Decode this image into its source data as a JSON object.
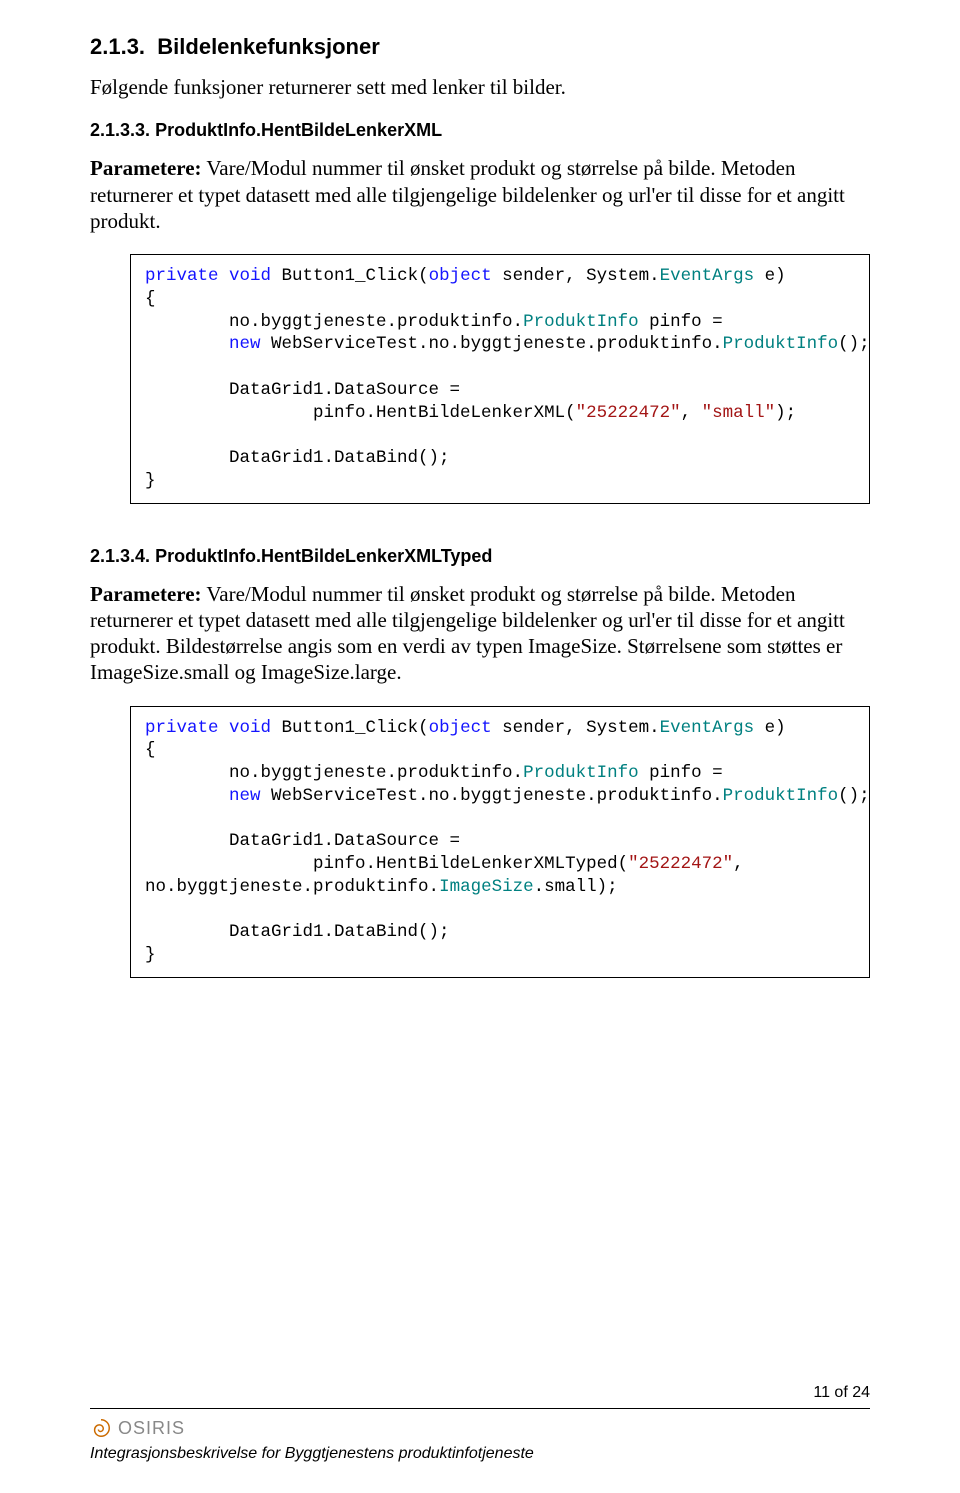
{
  "sec213": {
    "number": "2.1.3.",
    "title": "Bildelenkefunksjoner",
    "intro": "Følgende funksjoner returnerer sett med lenker til bilder."
  },
  "sec2133": {
    "number": "2.1.3.3.",
    "title": "ProduktInfo.HentBildeLenkerXML",
    "body": "Parametere: Vare/Modul nummer til ønsket produkt og størrelse på bilde. Metoden returnerer et typet datasett med alle tilgjengelige bildelenker og url'er til disse for et angitt produkt.",
    "code": {
      "l1a": "private",
      "l1b": "void",
      "l1c": " Button1_Click(",
      "l1d": "object",
      "l1e": " sender, System.",
      "l1f": "EventArgs",
      "l1g": " e)",
      "l2": "{",
      "l3a": "        no.byggtjeneste.produktinfo.",
      "l3b": "ProduktInfo",
      "l3c": " pinfo = ",
      "l4a": "        ",
      "l4b": "new",
      "l4c": " WebServiceTest.no.byggtjeneste.produktinfo.",
      "l4d": "ProduktInfo",
      "l4e": "();",
      "l6a": "        DataGrid1.DataSource = ",
      "l7a": "                pinfo.HentBildeLenkerXML(",
      "l7b": "\"25222472\"",
      "l7c": ", ",
      "l7d": "\"small\"",
      "l7e": ");",
      "l9a": "        DataGrid1.DataBind();",
      "l10": "}"
    }
  },
  "sec2134": {
    "number": "2.1.3.4.",
    "title": "ProduktInfo.HentBildeLenkerXMLTyped",
    "body": "Parametere: Vare/Modul nummer til ønsket produkt og størrelse på bilde. Metoden returnerer et typet datasett med alle tilgjengelige bildelenker og url'er til disse for et angitt produkt. Bildestørrelse angis som en verdi av typen ImageSize. Størrelsene som støttes er ImageSize.small og ImageSize.large.",
    "code": {
      "l1a": "private",
      "l1b": "void",
      "l1c": " Button1_Click(",
      "l1d": "object",
      "l1e": " sender, System.",
      "l1f": "EventArgs",
      "l1g": " e)",
      "l2": "{",
      "l3a": "        no.byggtjeneste.produktinfo.",
      "l3b": "ProduktInfo",
      "l3c": " pinfo = ",
      "l4a": "        ",
      "l4b": "new",
      "l4c": " WebServiceTest.no.byggtjeneste.produktinfo.",
      "l4d": "ProduktInfo",
      "l4e": "();",
      "l6a": "        DataGrid1.DataSource = ",
      "l7a": "                pinfo.HentBildeLenkerXMLTyped(",
      "l7b": "\"25222472\"",
      "l7c": ", ",
      "l8a": "no.byggtjeneste.produktinfo.",
      "l8b": "ImageSize",
      "l8c": ".small);",
      "l10a": "        DataGrid1.DataBind();",
      "l11": "}"
    }
  },
  "footer": {
    "page": "11 of 24",
    "logo_text": "OSIRIS",
    "tagline": "Integrasjonsbeskrivelse for Byggtjenestens produktinfotjeneste"
  }
}
